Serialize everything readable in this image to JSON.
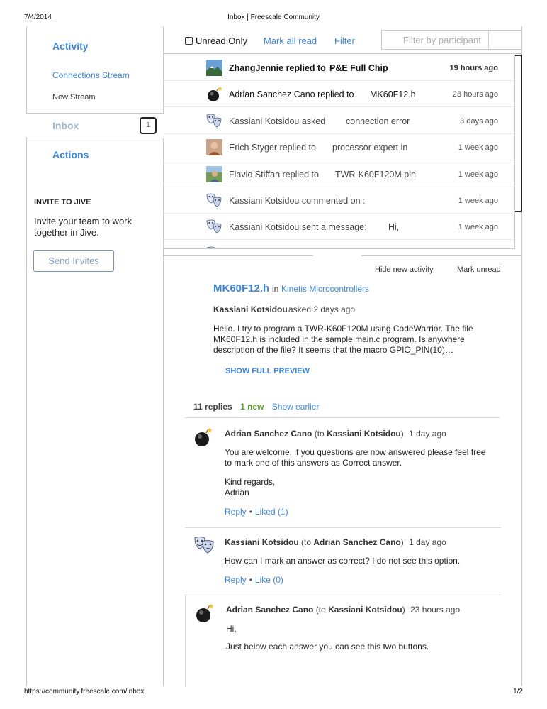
{
  "print": {
    "date": "7/4/2014",
    "title": "Inbox | Freescale Community",
    "url": "https://community.freescale.com/inbox",
    "page": "1/2"
  },
  "sidebar": {
    "activity": "Activity",
    "connections_stream": "Connections Stream",
    "new_stream": "New Stream",
    "inbox": "Inbox",
    "inbox_count": "1",
    "actions": "Actions",
    "invite_title": "INVITE TO JIVE",
    "invite_text": "Invite your team to work together in Jive.",
    "send_invites": "Send Invites"
  },
  "toolbar": {
    "unread_only": "Unread Only",
    "mark_all_read": "Mark all read",
    "filter": "Filter",
    "filter_placeholder": "Filter by participant"
  },
  "inbox": [
    {
      "who": "ZhangJennie replied to",
      "subject": "P&E Full Chip",
      "when": "19 hours ago",
      "avatar": "landscape-photo-avatar",
      "unread": true
    },
    {
      "who": "Adrian Sanchez Cano replied to",
      "subject": "MK60F12.h",
      "when": "23 hours ago",
      "avatar": "bomb-avatar",
      "unread": "soft"
    },
    {
      "who": "Kassiani Kotsidou asked",
      "subject": "connection error",
      "when": "3 days ago",
      "avatar": "theater-masks-avatar"
    },
    {
      "who": "Erich Styger replied to",
      "subject": "processor expert  in",
      "when": "1 week ago",
      "avatar": "person-photo-avatar"
    },
    {
      "who": "Flavio Stiffan replied to",
      "subject": "TWR-K60F120M pin",
      "when": "1 week ago",
      "avatar": "outdoor-photo-avatar"
    },
    {
      "who": "Kassiani Kotsidou commented on :",
      "subject": "",
      "when": "1 week ago",
      "avatar": "theater-masks-avatar"
    },
    {
      "who": "Kassiani Kotsidou sent a message:",
      "subject": "Hi,",
      "when": "1 week ago",
      "avatar": "theater-masks-avatar"
    }
  ],
  "detail": {
    "hide_new_activity": "Hide new activity",
    "mark_unread": "Mark unread",
    "title": "MK60F12.h",
    "in": "in",
    "place": "Kinetis Microcontrollers",
    "author": "Kassiani Kotsidou",
    "meta": "asked 2 days ago",
    "body": "Hello.   I try to program a TWR-K60F120M using CodeWarrior. The file MK60F12.h is included in the sample main.c program. Is anywhere description of the file? It seems that the macro GPIO_PIN(10)…",
    "show_full_preview": "SHOW FULL PREVIEW",
    "replies_count": "11 replies",
    "replies_new": "1 new",
    "show_earlier": "Show earlier"
  },
  "replies": [
    {
      "author": "Adrian Sanchez Cano",
      "to_prefix": "(to",
      "to": "Kassiani Kotsidou",
      "to_suffix": ")",
      "when": "1 day ago",
      "p1": "You are welcome, if you questions are now answered please feel free to mark one of this answers as Correct answer.",
      "p2": "Kind regards,",
      "p3": "Adrian",
      "reply": "Reply",
      "like": "Liked (1)"
    },
    {
      "author": "Kassiani Kotsidou",
      "to_prefix": "(to",
      "to": "Adrian Sanchez Cano",
      "to_suffix": ")",
      "when": "1 day ago",
      "p1": "How can I mark an answer as correct? I do not see this option.",
      "reply": "Reply",
      "like": "Like (0)"
    },
    {
      "author": "Adrian Sanchez Cano",
      "to_prefix": "(to",
      "to": "Kassiani Kotsidou",
      "to_suffix": ")",
      "when": "23 hours ago",
      "p1": "Hi,",
      "p2": "Just below each answer you can see this two buttons."
    }
  ]
}
